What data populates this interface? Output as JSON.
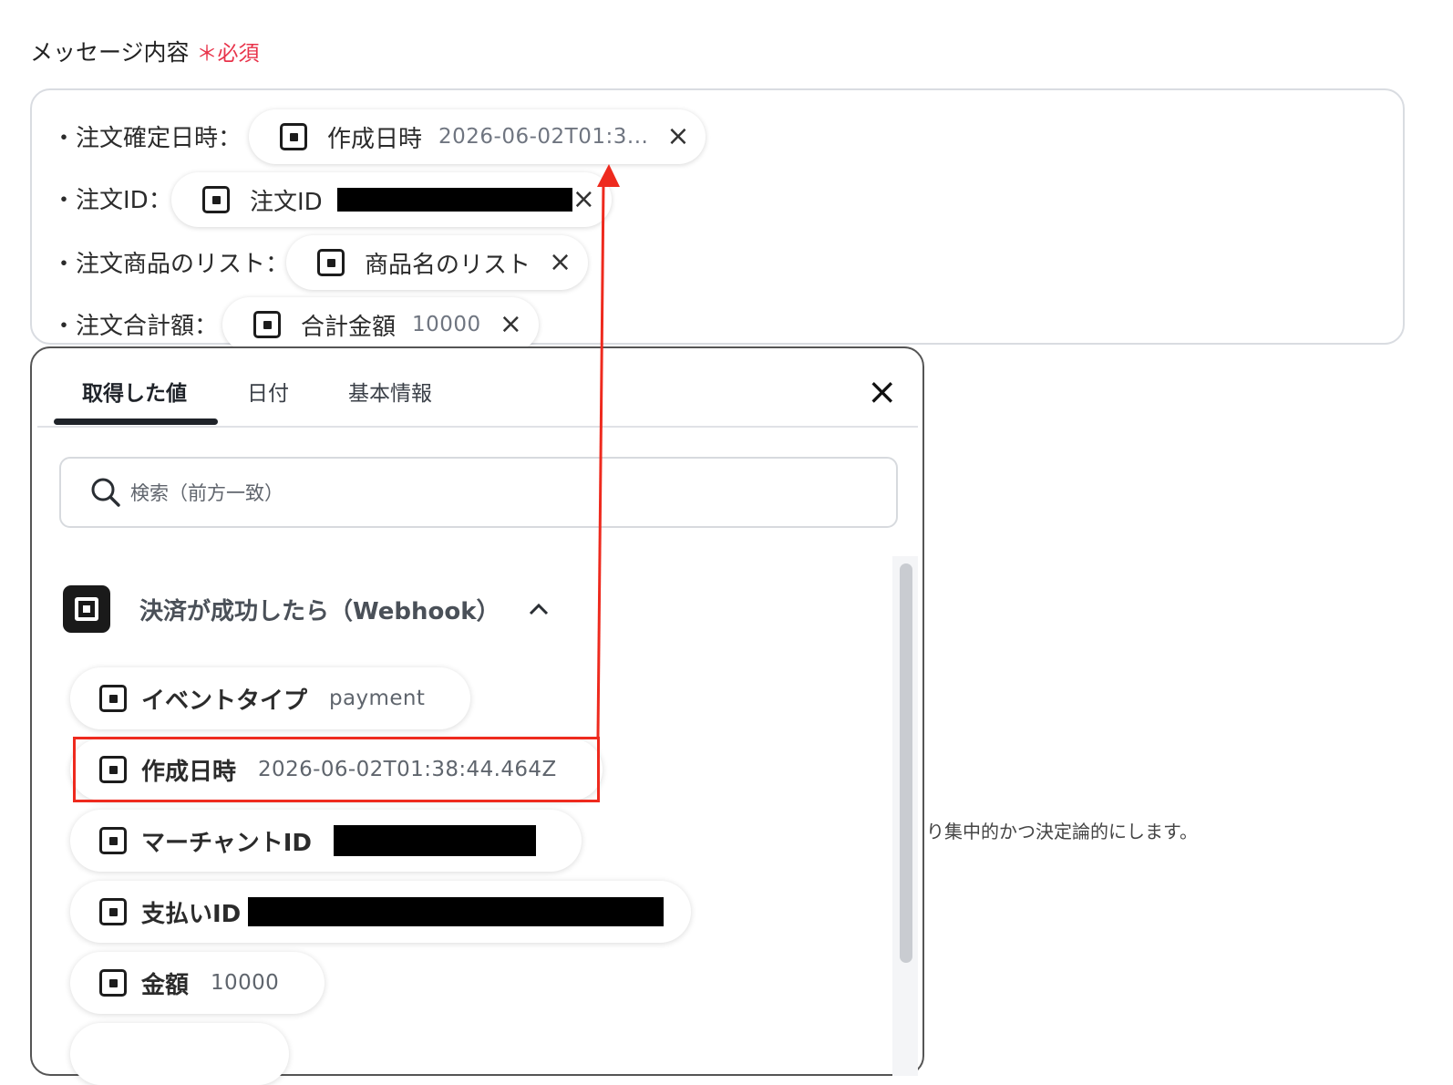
{
  "field": {
    "label": "メッセージ内容",
    "required_mark": "＊",
    "required_text": "必須"
  },
  "editor": {
    "lines": [
      {
        "label": "・注文確定日時：",
        "chip_name": "作成日時",
        "chip_value": "2026-06-02T01:3..."
      },
      {
        "label": "・注文ID：",
        "chip_name": "注文ID",
        "chip_value": ""
      },
      {
        "label": "・注文商品のリスト：",
        "chip_name": "商品名のリスト",
        "chip_value": ""
      },
      {
        "label": "・注文合計額：",
        "chip_name": "合計金額",
        "chip_value": "10000"
      }
    ],
    "remove_icon": "×"
  },
  "background_note": "り集中的かつ決定論的にします。",
  "popup": {
    "tabs": [
      "取得した値",
      "日付",
      "基本情報"
    ],
    "close_icon": "×",
    "search": {
      "placeholder": "検索（前方一致）"
    },
    "section": {
      "title": "決済が成功したら（Webhook）",
      "chevron": "^"
    },
    "items": [
      {
        "name": "イベントタイプ",
        "value": "payment"
      },
      {
        "name": "作成日時",
        "value": "2026-06-02T01:38:44.464Z"
      },
      {
        "name": "マーチャントID",
        "value": ""
      },
      {
        "name": "支払いID",
        "value": ""
      },
      {
        "name": "金額",
        "value": "10000"
      }
    ]
  },
  "colors": {
    "required": "#e8334a",
    "highlight": "#ee2a1e",
    "active_tab": "#1f2329"
  }
}
